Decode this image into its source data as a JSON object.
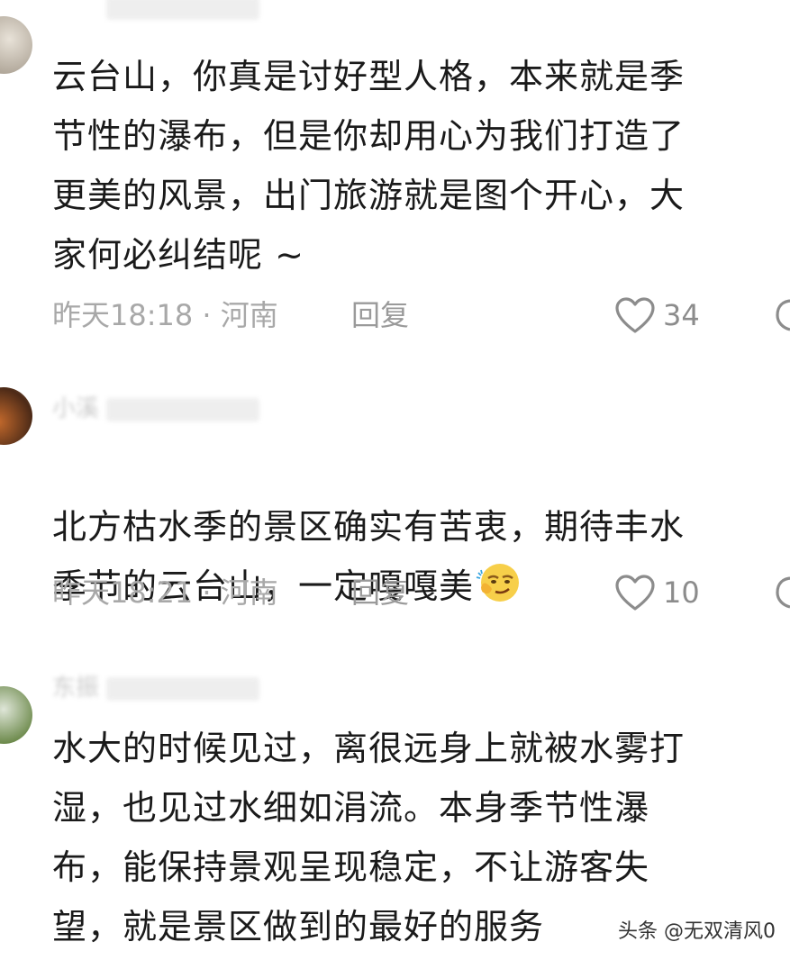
{
  "comments": [
    {
      "username": "",
      "text": "云台山，你真是讨好型人格，本来就是季\n节性的瀑布，但是你却用心为我们打造了\n更美的风景，出门旅游就是图个开心，大\n家何必纠结呢 ~",
      "time_location": "昨天18:18 · 河南",
      "reply_label": "回复",
      "likes": "34"
    },
    {
      "username": "小溪",
      "text": "北方枯水季的景区确实有苦衷，期待丰水\n季节的云台山，一定嘎嘎美",
      "time_location": "昨天18:21 · 河南",
      "reply_label": "回复",
      "likes": "10"
    },
    {
      "username": "东振",
      "text": "水大的时候见过，离很远身上就被水雾打\n湿，也见过水细如涓流。本身季节性瀑\n布，能保持景观呈现稳定，不让游客失\n望，就是景区做到的最好的服务"
    }
  ],
  "watermark": "头条 @无双清风0",
  "colors": {
    "meta": "#a8a8a8",
    "text": "#1a1a1a",
    "icon": "#8c8c8c"
  },
  "icons": [
    "heart-icon",
    "smirk-emoji-icon",
    "share-icon"
  ]
}
